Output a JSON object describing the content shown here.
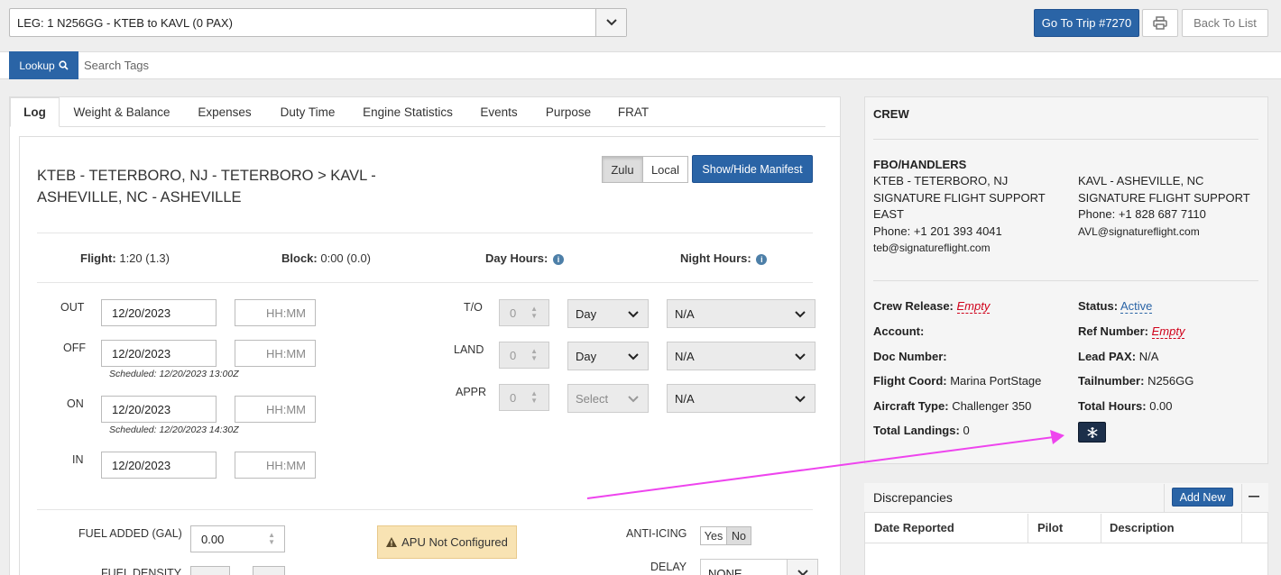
{
  "leg_select": {
    "value": "LEG: 1 N256GG - KTEB to KAVL (0 PAX)"
  },
  "header_buttons": {
    "go_to_trip": "Go To Trip #7270",
    "back_to_list": "Back To List"
  },
  "search": {
    "lookup_label": "Lookup",
    "placeholder": "Search Tags"
  },
  "tabs": [
    "Log",
    "Weight & Balance",
    "Expenses",
    "Duty Time",
    "Engine Statistics",
    "Events",
    "Purpose",
    "FRAT"
  ],
  "log": {
    "route": "KTEB - TETERBORO, NJ - TETERBORO > KAVL - ASHEVILLE, NC - ASHEVILLE",
    "time_mode": {
      "zulu": "Zulu",
      "local": "Local",
      "selected": "Zulu"
    },
    "show_hide_manifest": "Show/Hide Manifest",
    "flight_label": "Flight:",
    "flight_value": "1:20 (1.3)",
    "block_label": "Block:",
    "block_value": "0:00 (0.0)",
    "day_hours_label": "Day Hours:",
    "night_hours_label": "Night Hours:",
    "times": [
      {
        "label": "OUT",
        "date": "12/20/2023",
        "time_placeholder": "HH:MM",
        "scheduled": ""
      },
      {
        "label": "OFF",
        "date": "12/20/2023",
        "time_placeholder": "HH:MM",
        "scheduled": "Scheduled: 12/20/2023 13:00Z"
      },
      {
        "label": "ON",
        "date": "12/20/2023",
        "time_placeholder": "HH:MM",
        "scheduled": "Scheduled: 12/20/2023 14:30Z"
      },
      {
        "label": "IN",
        "date": "12/20/2023",
        "time_placeholder": "HH:MM",
        "scheduled": ""
      }
    ],
    "ops": [
      {
        "label": "T/O",
        "count": "0",
        "period": "Day",
        "approach": "N/A"
      },
      {
        "label": "LAND",
        "count": "0",
        "period": "Day",
        "approach": "N/A"
      },
      {
        "label": "APPR",
        "count": "0",
        "period": "Select",
        "approach": "N/A"
      }
    ],
    "fuel_added_label": "FUEL ADDED (GAL)",
    "fuel_added_value": "0.00",
    "fuel_density_label": "FUEL DENSITY",
    "apu_warning": "APU Not Configured",
    "anti_icing_label": "ANTI-ICING",
    "anti_icing_yes": "Yes",
    "anti_icing_no": "No",
    "delay_label": "DELAY",
    "delay_value": "NONE"
  },
  "crew_panel": {
    "crew_heading": "CREW",
    "fbo_heading": "FBO/HANDLERS",
    "fbo_origin": [
      "KTEB - TETERBORO, NJ",
      "SIGNATURE FLIGHT SUPPORT",
      "EAST",
      "Phone: +1 201 393 4041",
      "teb@signatureflight.com"
    ],
    "fbo_dest": [
      "KAVL - ASHEVILLE, NC",
      "SIGNATURE FLIGHT SUPPORT",
      "Phone: +1 828 687 7110",
      "AVL@signatureflight.com"
    ],
    "crew_release_label": "Crew Release:",
    "crew_release_value": "Empty",
    "status_label": "Status:",
    "status_value": "Active",
    "account_label": "Account:",
    "ref_number_label": "Ref Number:",
    "ref_number_value": "Empty",
    "doc_number_label": "Doc Number:",
    "lead_pax_label": "Lead PAX:",
    "lead_pax_value": "N/A",
    "flight_coord_label": "Flight Coord:",
    "flight_coord_value": "Marina PortStage",
    "tailnumber_label": "Tailnumber:",
    "tailnumber_value": "N256GG",
    "aircraft_type_label": "Aircraft Type:",
    "aircraft_type_value": "Challenger 350",
    "total_hours_label": "Total Hours:",
    "total_hours_value": "0.00",
    "total_landings_label": "Total Landings:",
    "total_landings_value": "0"
  },
  "discrepancies": {
    "title": "Discrepancies",
    "add_new": "Add New",
    "columns": [
      "Date Reported",
      "Pilot",
      "Description"
    ]
  },
  "colors": {
    "primary": "#2a64a6",
    "annotation_arrow": "#ee44ee",
    "empty_red": "#d0021b"
  }
}
